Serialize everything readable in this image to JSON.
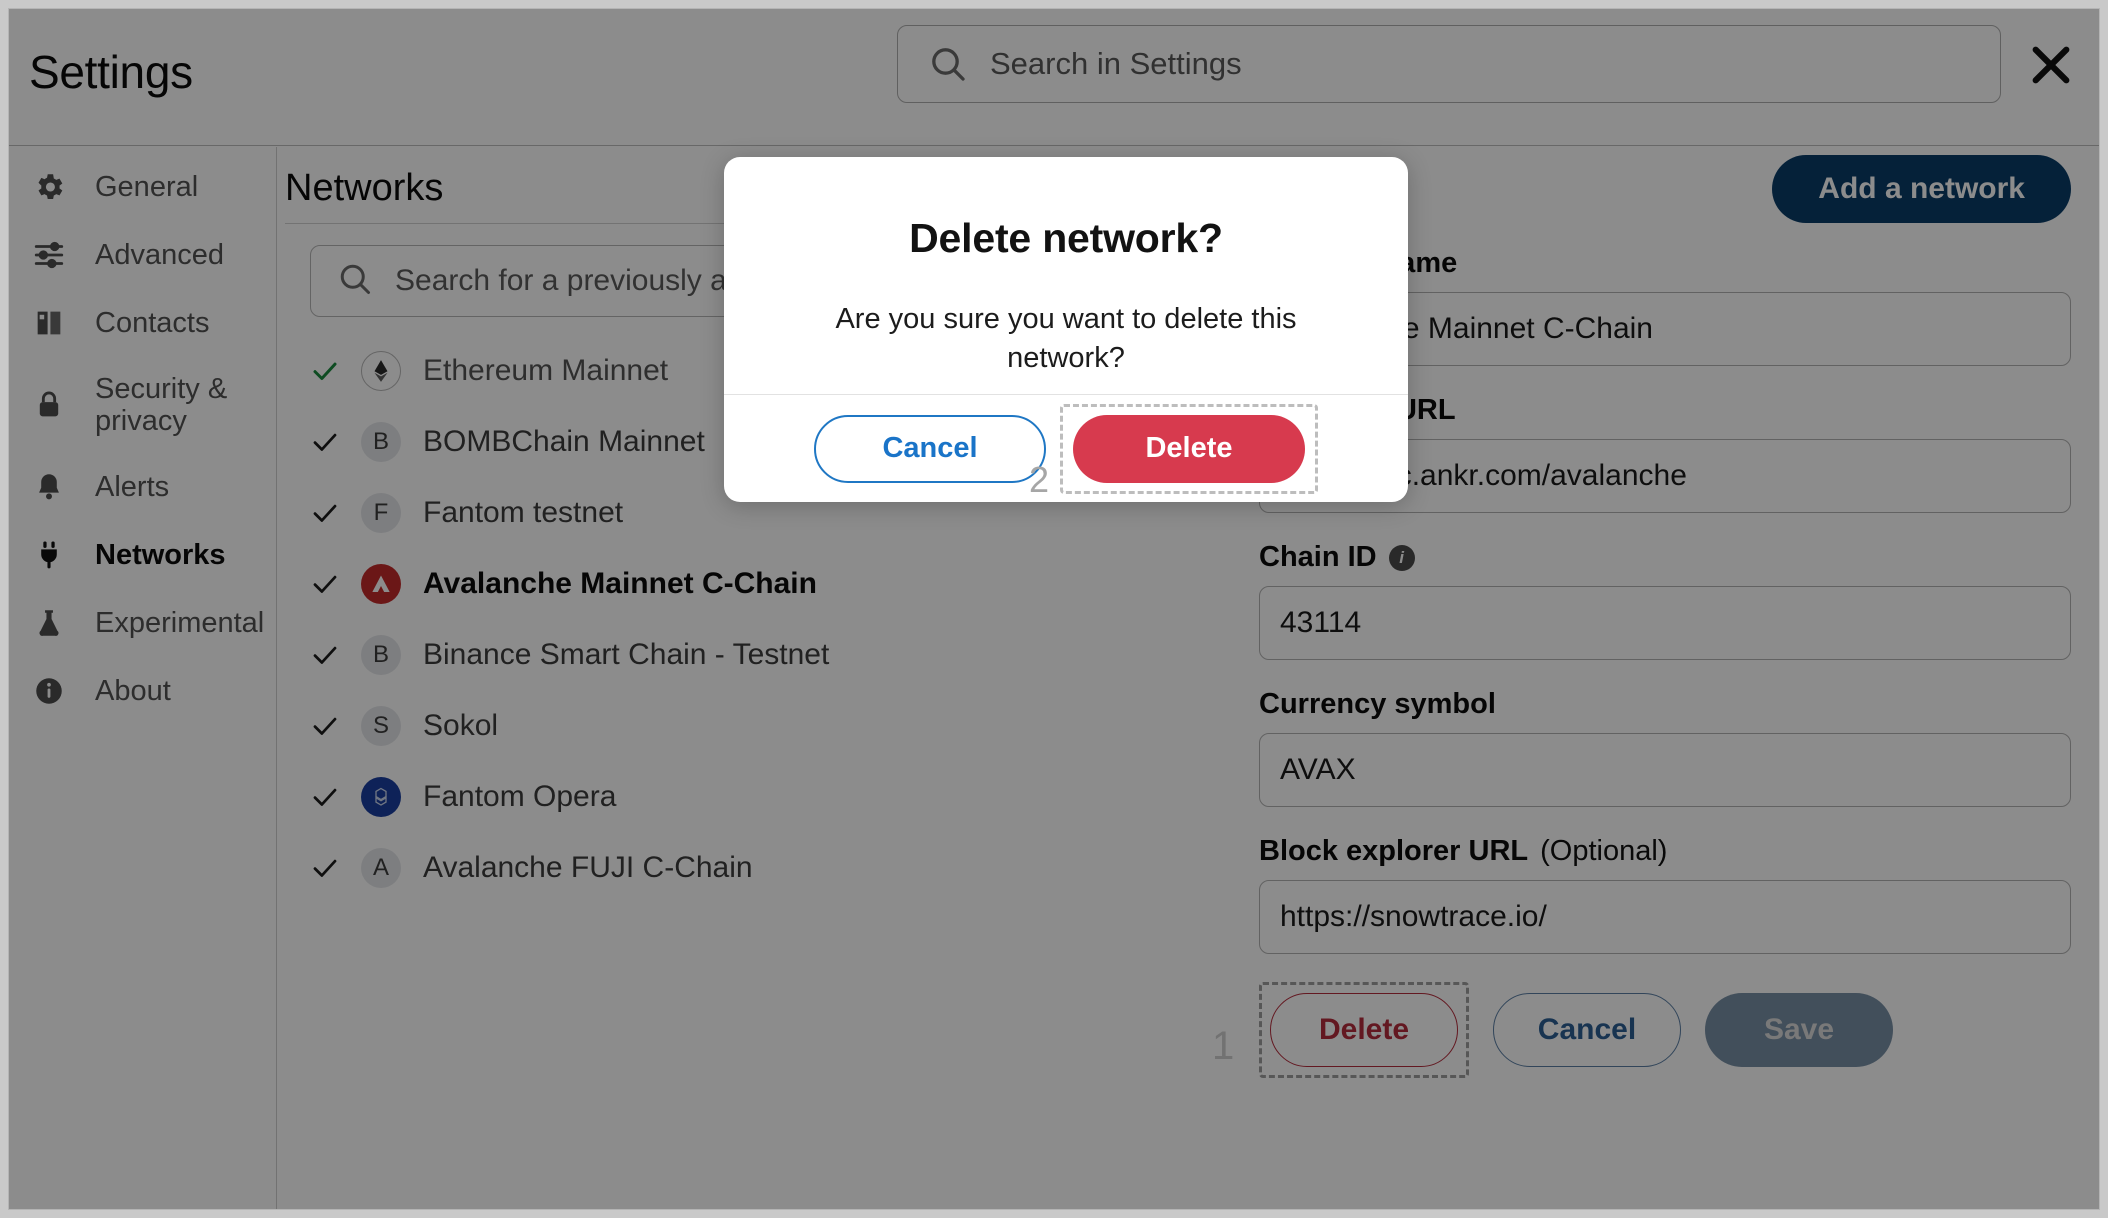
{
  "window": {
    "title": "Settings"
  },
  "header": {
    "title": "Settings",
    "search_placeholder": "Search in Settings",
    "search_value": "",
    "close_label": "Close",
    "search_icon": "search-icon",
    "close_icon": "close-icon"
  },
  "sidebar": {
    "items": [
      {
        "label": "General",
        "icon": "gear-icon",
        "active": false
      },
      {
        "label": "Advanced",
        "icon": "sliders-icon",
        "active": false
      },
      {
        "label": "Contacts",
        "icon": "book-icon",
        "active": false
      },
      {
        "label": "Security & privacy",
        "icon": "lock-icon",
        "active": false
      },
      {
        "label": "Alerts",
        "icon": "bell-icon",
        "active": false
      },
      {
        "label": "Networks",
        "icon": "plug-icon",
        "active": true
      },
      {
        "label": "Experimental",
        "icon": "flask-icon",
        "active": false
      },
      {
        "label": "About",
        "icon": "info-icon",
        "active": false
      }
    ]
  },
  "networks_panel": {
    "heading": "Networks",
    "search_placeholder": "Search for a previously added network",
    "search_value": "",
    "add_network_label": "Add a network",
    "add_network_color": "#0a3d69",
    "list": [
      {
        "name": "Ethereum Mainnet",
        "badge": "",
        "logo": "ethereum-logo",
        "check_color": "#1b8a3e",
        "selected": false,
        "muted": true
      },
      {
        "name": "BOMBChain Mainnet",
        "badge": "B",
        "logo": "letter-badge",
        "check_color": "#1c1c1c",
        "selected": false,
        "muted": false
      },
      {
        "name": "Fantom testnet",
        "badge": "F",
        "logo": "letter-badge",
        "check_color": "#1c1c1c",
        "selected": false,
        "muted": false
      },
      {
        "name": "Avalanche Mainnet C-Chain",
        "badge": "",
        "logo": "avalanche-logo",
        "check_color": "#1c1c1c",
        "selected": true,
        "muted": false
      },
      {
        "name": "Binance Smart Chain - Testnet",
        "badge": "B",
        "logo": "letter-badge",
        "check_color": "#1c1c1c",
        "selected": false,
        "muted": false
      },
      {
        "name": "Sokol",
        "badge": "S",
        "logo": "letter-badge",
        "check_color": "#1c1c1c",
        "selected": false,
        "muted": false
      },
      {
        "name": "Fantom Opera",
        "badge": "",
        "logo": "fantom-logo",
        "check_color": "#1c1c1c",
        "selected": false,
        "muted": false
      },
      {
        "name": "Avalanche FUJI C-Chain",
        "badge": "A",
        "logo": "letter-badge",
        "check_color": "#1c1c1c",
        "selected": false,
        "muted": false
      }
    ]
  },
  "network_form": {
    "fields": {
      "network_name": {
        "label": "Network name",
        "value": "Avalanche Mainnet C-Chain"
      },
      "rpc_url": {
        "label": "New RPC URL",
        "value": "https://rpc.ankr.com/avalanche"
      },
      "chain_id": {
        "label": "Chain ID",
        "value": "43114",
        "info_icon": "info-icon"
      },
      "currency_symbol": {
        "label": "Currency symbol",
        "value": "AVAX"
      },
      "block_explorer_url": {
        "label": "Block explorer URL",
        "optional_suffix": "(Optional)",
        "value": "https://snowtrace.io/"
      }
    },
    "actions": {
      "delete_label": "Delete",
      "cancel_label": "Cancel",
      "save_label": "Save",
      "delete_color": "#b52d3c",
      "cancel_color": "#2c5f94",
      "save_bg": "#7990a6"
    }
  },
  "annotations": {
    "marker_one": "1",
    "marker_two": "2"
  },
  "modal": {
    "title": "Delete network?",
    "message": "Are you sure you want to delete this network?",
    "cancel_label": "Cancel",
    "delete_label": "Delete",
    "delete_bg": "#d73a4e",
    "cancel_color": "#1a74c8"
  }
}
